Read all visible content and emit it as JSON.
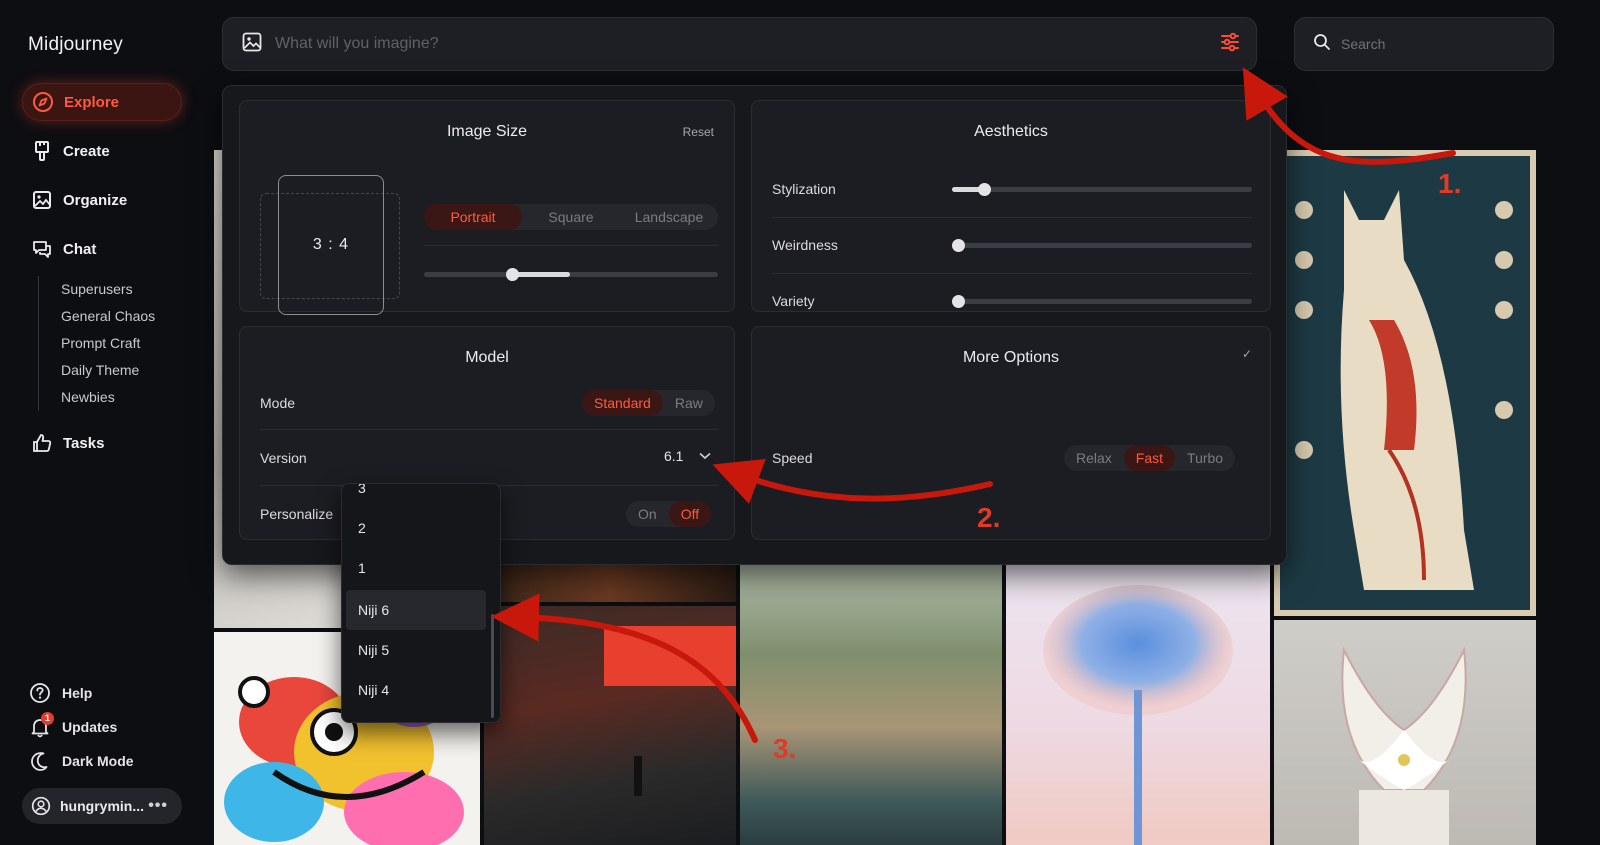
{
  "sidebar": {
    "logo": "Midjourney",
    "nav": [
      {
        "label": "Explore",
        "icon": "compass-icon",
        "active": true
      },
      {
        "label": "Create",
        "icon": "brush-icon"
      },
      {
        "label": "Organize",
        "icon": "image-icon"
      },
      {
        "label": "Chat",
        "icon": "chat-icon"
      }
    ],
    "chat_rooms": [
      "Superusers",
      "General Chaos",
      "Prompt Craft",
      "Daily Theme",
      "Newbies"
    ],
    "tasks": "Tasks",
    "help": "Help",
    "updates": "Updates",
    "updates_badge": "1",
    "dark_mode": "Dark Mode",
    "user": "hungrymin..."
  },
  "prompt": {
    "placeholder": "What will you imagine?"
  },
  "search": {
    "placeholder": "Search"
  },
  "panel": {
    "image_size": {
      "title": "Image Size",
      "reset": "Reset",
      "ratio": "3 : 4",
      "orientations": [
        "Portrait",
        "Square",
        "Landscape"
      ],
      "selected": "Portrait"
    },
    "aesthetics": {
      "title": "Aesthetics",
      "sliders": [
        {
          "label": "Stylization",
          "value": 0.11
        },
        {
          "label": "Weirdness",
          "value": 0
        },
        {
          "label": "Variety",
          "value": 0
        }
      ]
    },
    "model": {
      "title": "Model",
      "mode_label": "Mode",
      "modes": [
        "Standard",
        "Raw"
      ],
      "mode_selected": "Standard",
      "version_label": "Version",
      "version_value": "6.1",
      "personalize_label": "Personalize",
      "personalize_options": [
        "On",
        "Off"
      ],
      "personalize_selected": "Off"
    },
    "more_options": {
      "title": "More Options",
      "speed_label": "Speed",
      "speeds": [
        "Relax",
        "Fast",
        "Turbo"
      ],
      "speed_selected": "Fast"
    }
  },
  "version_dropdown": {
    "items": [
      "3",
      "2",
      "1",
      "Niji 6",
      "Niji 5",
      "Niji 4"
    ],
    "highlighted": "Niji 6"
  },
  "annotations": [
    "1.",
    "2.",
    "3."
  ],
  "colors": {
    "accent": "#ff5a3c",
    "annotation": "#c8180c",
    "background": "#0d0e12"
  }
}
